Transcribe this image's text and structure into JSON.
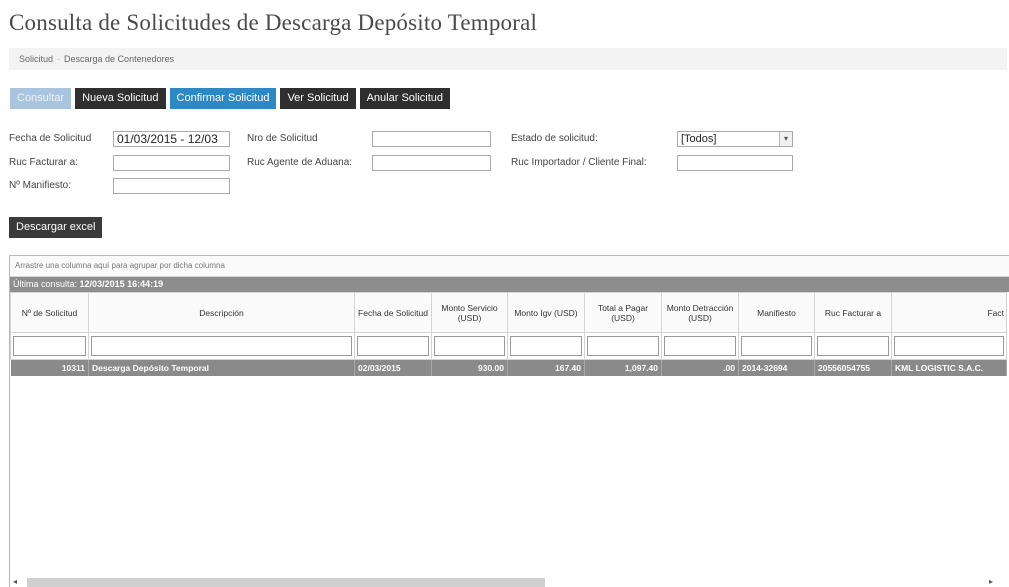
{
  "page_title": "Consulta de Solicitudes de Descarga Depósito Temporal",
  "breadcrumb": [
    "Solicitud",
    "Descarga de Contenedores"
  ],
  "toolbar": {
    "consultar": "Consultar",
    "nueva": "Nueva Solicitud",
    "confirmar": "Confirmar Solicitud",
    "ver": "Ver Solicitud",
    "anular": "Anular Solicitud"
  },
  "form": {
    "fecha_label": "Fecha de Solicitud",
    "fecha_value": "01/03/2015 - 12/03",
    "nro_label": "Nro de Solicitud",
    "nro_value": "",
    "estado_label": "Estado de solicitud:",
    "estado_value": "[Todos]",
    "ruc_facturar_label": "Ruc Facturar a:",
    "ruc_facturar_value": "",
    "ruc_agente_label": "Ruc Agente de Aduana:",
    "ruc_agente_value": "",
    "ruc_importador_label": "Ruc Importador / Cliente Final:",
    "ruc_importador_value": "",
    "manifiesto_label": "Nº Manifiesto:",
    "manifiesto_value": ""
  },
  "excel_button": "Descargar excel",
  "grid": {
    "group_hint": "Arrastre una columna aquí para agrupar por dicha columna",
    "last_query_label": "Última consulta:",
    "last_query_value": "12/03/2015 16:44:19",
    "columns": [
      "Nº de Solicitud",
      "Descripción",
      "Fecha de Solicitud",
      "Monto Servicio (USD)",
      "Monto Igv (USD)",
      "Total a Pagar (USD)",
      "Monto Detracción (USD)",
      "Manifiesto",
      "Ruc Facturar a",
      "Fact"
    ],
    "rows": [
      [
        "10311",
        "Descarga Depósito Temporal",
        "02/03/2015",
        "930.00",
        "167.40",
        "1,097.40",
        ".00",
        "2014-32694",
        "20556054755",
        "KML LOGISTIC S.A.C."
      ]
    ]
  },
  "icons": {
    "select_arrow": "chevron-down-icon",
    "scroll_left": "arrow-left-icon",
    "scroll_right": "arrow-right-icon"
  },
  "colors": {
    "dark_button": "#2f2f2f",
    "blue_button": "#2d89c5",
    "disabled_button": "#a9c4de",
    "selected_row": "#8a8a8a"
  }
}
